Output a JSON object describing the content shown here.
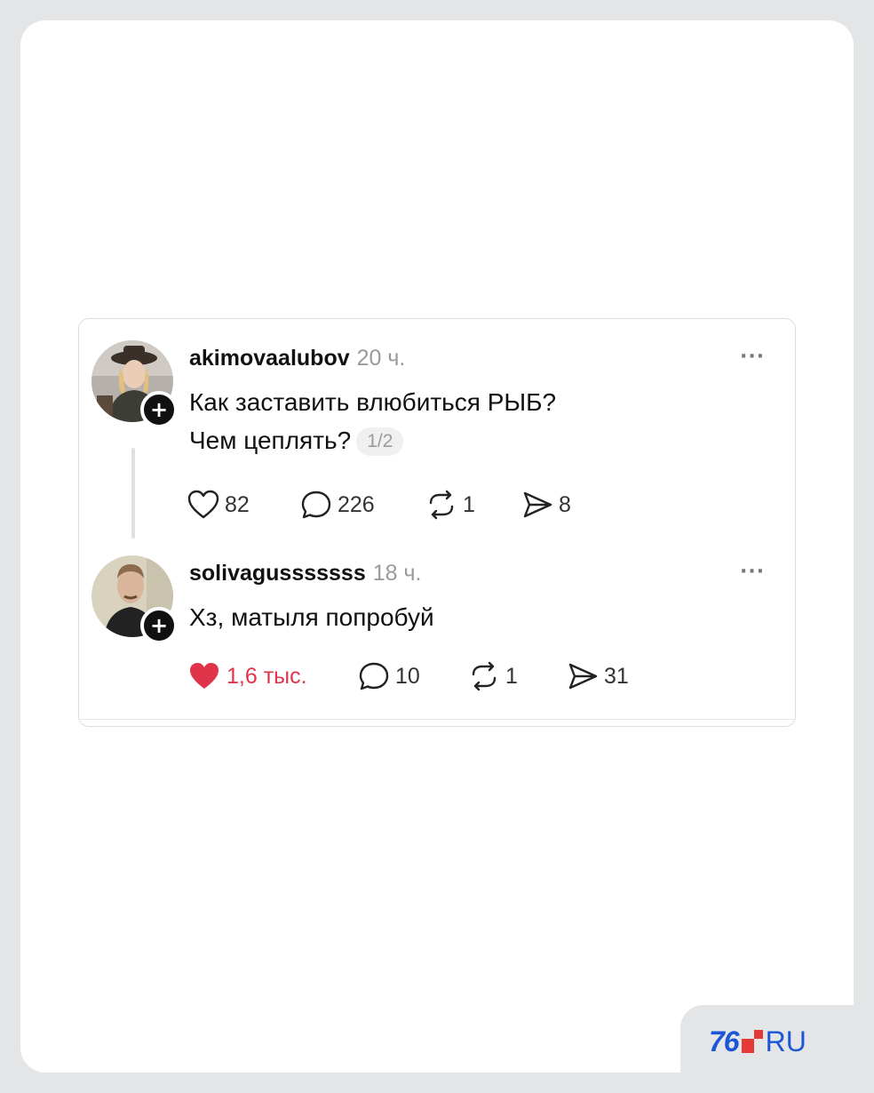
{
  "posts": [
    {
      "username": "akimovaalubov",
      "time": "20 ч.",
      "text_line1": "Как заставить влюбиться РЫБ?",
      "text_line2": "Чем цеплять?",
      "page_indicator": "1/2",
      "more": "···",
      "likes": "82",
      "replies": "226",
      "reposts": "1",
      "shares": "8",
      "liked": false
    },
    {
      "username": "solivagusssssss",
      "time": "18 ч.",
      "text_line1": "Хз, матыля попробуй",
      "more": "···",
      "likes": "1,6 тыс.",
      "replies": "10",
      "reposts": "1",
      "shares": "31",
      "liked": true
    }
  ],
  "follow_symbol": "+",
  "brand": {
    "number": "76",
    "suffix": "RU"
  },
  "colors": {
    "like_active": "#e0344a",
    "brand_blue": "#1a56d6",
    "brand_red": "#e53935"
  }
}
